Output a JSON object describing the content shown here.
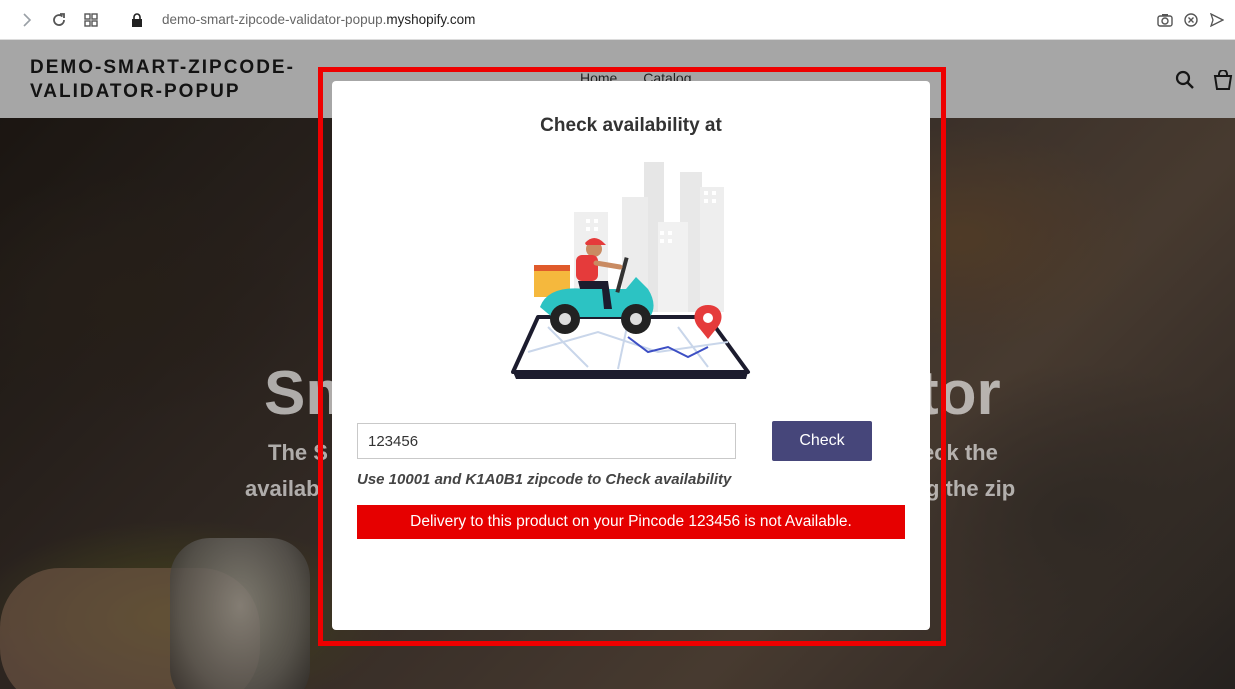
{
  "browser": {
    "url_prefix": "demo-smart-zipcode-validator-popup.",
    "url_domain": "myshopify.com"
  },
  "store": {
    "logo_line1": "DEMO-SMART-ZIPCODE-",
    "logo_line2": "VALIDATOR-POPUP",
    "nav": [
      "Home",
      "Catalog"
    ],
    "hero_title_left": "Sm",
    "hero_title_right": "tor",
    "hero_sub_left_1": "The S",
    "hero_sub_right_1": "eck the",
    "hero_sub_left_2": "availab",
    "hero_sub_right_2": "g the zip"
  },
  "popup": {
    "title": "Check availability at",
    "input_value": "123456",
    "check_label": "Check",
    "hint": "Use 10001 and K1A0B1 zipcode to Check availability",
    "error": "Delivery to this product on your Pincode 123456 is not Available."
  },
  "colors": {
    "highlight": "#ee0000",
    "button": "#46467a",
    "error_bg": "#e60000"
  }
}
